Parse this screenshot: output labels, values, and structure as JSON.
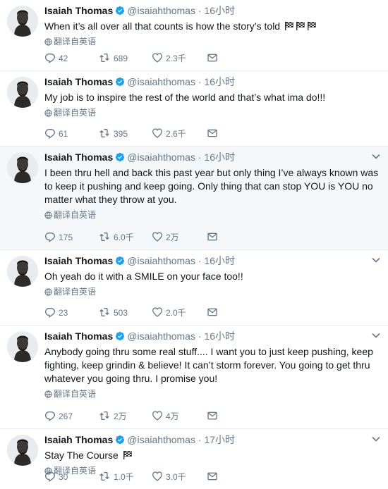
{
  "ui": {
    "translate_label": "翻译自英语"
  },
  "tweets": [
    {
      "name": "Isaiah Thomas",
      "handle": "@isaiahthomas",
      "dot": "·",
      "time": "16小时",
      "text": "When it’s all over all that counts is how the story’s told ",
      "flags": 3,
      "replies": "42",
      "retweets": "689",
      "likes": "2.3千",
      "show_chevron": false
    },
    {
      "name": "Isaiah Thomas",
      "handle": "@isaiahthomas",
      "dot": "·",
      "time": "16小时",
      "text": "My job is to inspire the rest of the world and that’s what ima do!!!",
      "flags": 0,
      "replies": "61",
      "retweets": "395",
      "likes": "2.6千",
      "show_chevron": false
    },
    {
      "name": "Isaiah Thomas",
      "handle": "@isaiahthomas",
      "dot": "·",
      "time": "16小时",
      "text": "I been thru hell and back this past year but only thing I’ve always known was to keep it pushing and keep going. Only thing that can stop YOU is YOU no matter what they throw at you.",
      "flags": 0,
      "replies": "175",
      "retweets": "6.0千",
      "likes": "2万",
      "show_chevron": true
    },
    {
      "name": "Isaiah Thomas",
      "handle": "@isaiahthomas",
      "dot": "·",
      "time": "16小时",
      "text": "Oh yeah do it with a SMILE on your face too!!",
      "flags": 0,
      "replies": "23",
      "retweets": "503",
      "likes": "2.0千",
      "show_chevron": true
    },
    {
      "name": "Isaiah Thomas",
      "handle": "@isaiahthomas",
      "dot": "·",
      "time": "16小时",
      "text": "Anybody going thru some real stuff.... I want you to just keep pushing, keep fighting, keep grindin & believe! It can’t storm forever. You going to get thru whatever you going thru. I promise you!",
      "flags": 0,
      "replies": "267",
      "retweets": "2万",
      "likes": "4万",
      "show_chevron": true
    },
    {
      "name": "Isaiah Thomas",
      "handle": "@isaiahthomas",
      "dot": "·",
      "time": "17小时",
      "text": "Stay The Course ",
      "flags": 1,
      "replies": "30",
      "retweets": "1.0千",
      "likes": "3.0千",
      "show_chevron": true
    }
  ],
  "colors": {
    "verified": "#1da1f2",
    "muted": "#657786",
    "text": "#14171a",
    "highlight_bg": "#f5f8fa"
  },
  "icons": {
    "reply": "reply-icon",
    "retweet": "retweet-icon",
    "like": "heart-icon",
    "dm": "envelope-icon",
    "verified": "verified-badge-icon",
    "globe": "globe-icon",
    "flag": "checkered-flag-icon",
    "chevron": "chevron-down-icon"
  }
}
